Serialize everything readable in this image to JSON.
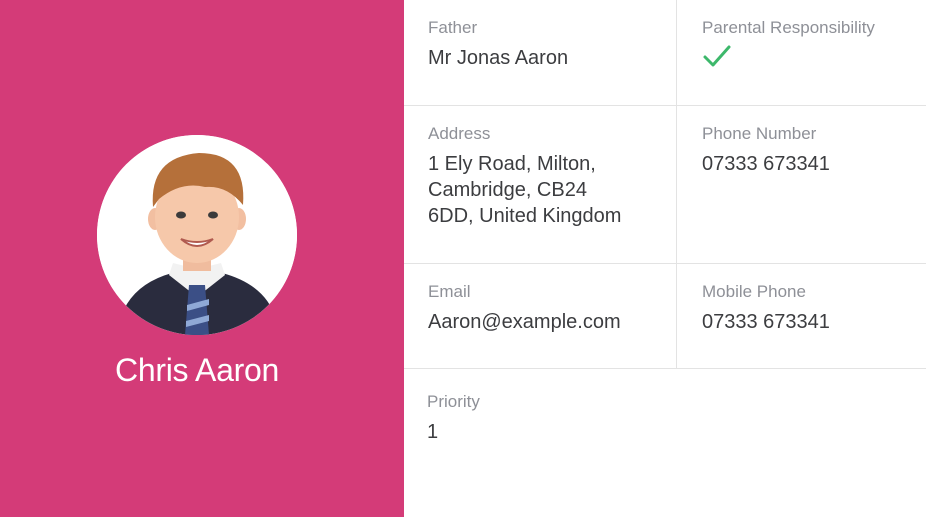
{
  "child": {
    "name": "Chris Aaron",
    "photo_icon": "child-photo",
    "accent_color": "#d43b78"
  },
  "contact": {
    "father": {
      "label": "Father",
      "value": "Mr Jonas Aaron"
    },
    "parental_responsibility": {
      "label": "Parental Responsibility",
      "checked": true,
      "icon": "checkmark-icon",
      "color": "#3db86b"
    },
    "address": {
      "label": "Address",
      "lines": [
        "1 Ely Road, Milton,",
        "Cambridge, CB24",
        "6DD, United Kingdom"
      ]
    },
    "phone": {
      "label": "Phone Number",
      "value": "07333 673341"
    },
    "email": {
      "label": "Email",
      "value": "Aaron@example.com"
    },
    "mobile": {
      "label": "Mobile Phone",
      "value": "07333 673341"
    },
    "priority": {
      "label": "Priority",
      "value": "1"
    }
  }
}
